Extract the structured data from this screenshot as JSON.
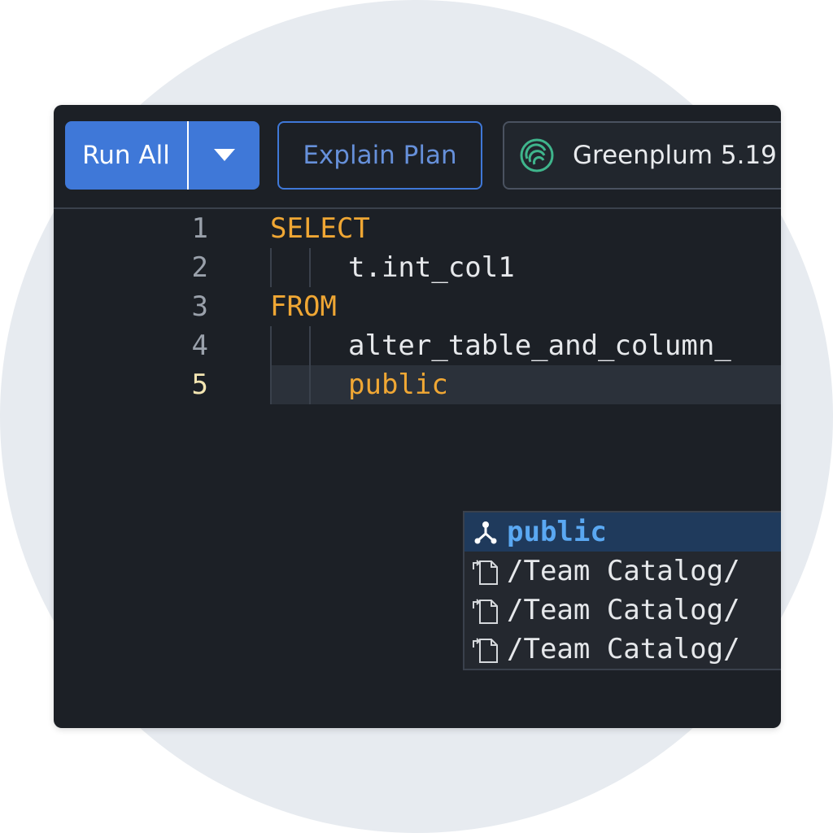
{
  "toolbar": {
    "run_all_label": "Run All",
    "run_menu_icon": "chevron-down-icon",
    "explain_plan_label": "Explain Plan",
    "database_label": "Greenplum 5.19",
    "database_icon": "greenplum-logo-icon"
  },
  "editor": {
    "lines": [
      {
        "number": "1",
        "text": "SELECT"
      },
      {
        "number": "2",
        "text": "t.int_col1"
      },
      {
        "number": "3",
        "text": "FROM"
      },
      {
        "number": "4",
        "text": "alter_table_and_column_"
      },
      {
        "number": "5",
        "text": "public"
      }
    ]
  },
  "autocomplete": {
    "items": [
      {
        "label": "public",
        "icon": "schema-icon",
        "selected": true
      },
      {
        "label": "/Team Catalog/",
        "icon": "document-link-icon",
        "selected": false
      },
      {
        "label": "/Team Catalog/",
        "icon": "document-link-icon",
        "selected": false
      },
      {
        "label": "/Team Catalog/",
        "icon": "document-link-icon",
        "selected": false
      }
    ]
  },
  "colors": {
    "accent": "#3f78d8",
    "keyword": "#f0a734",
    "editor_bg": "#1c2026",
    "suggestion_highlight": "#5aa8f2"
  }
}
